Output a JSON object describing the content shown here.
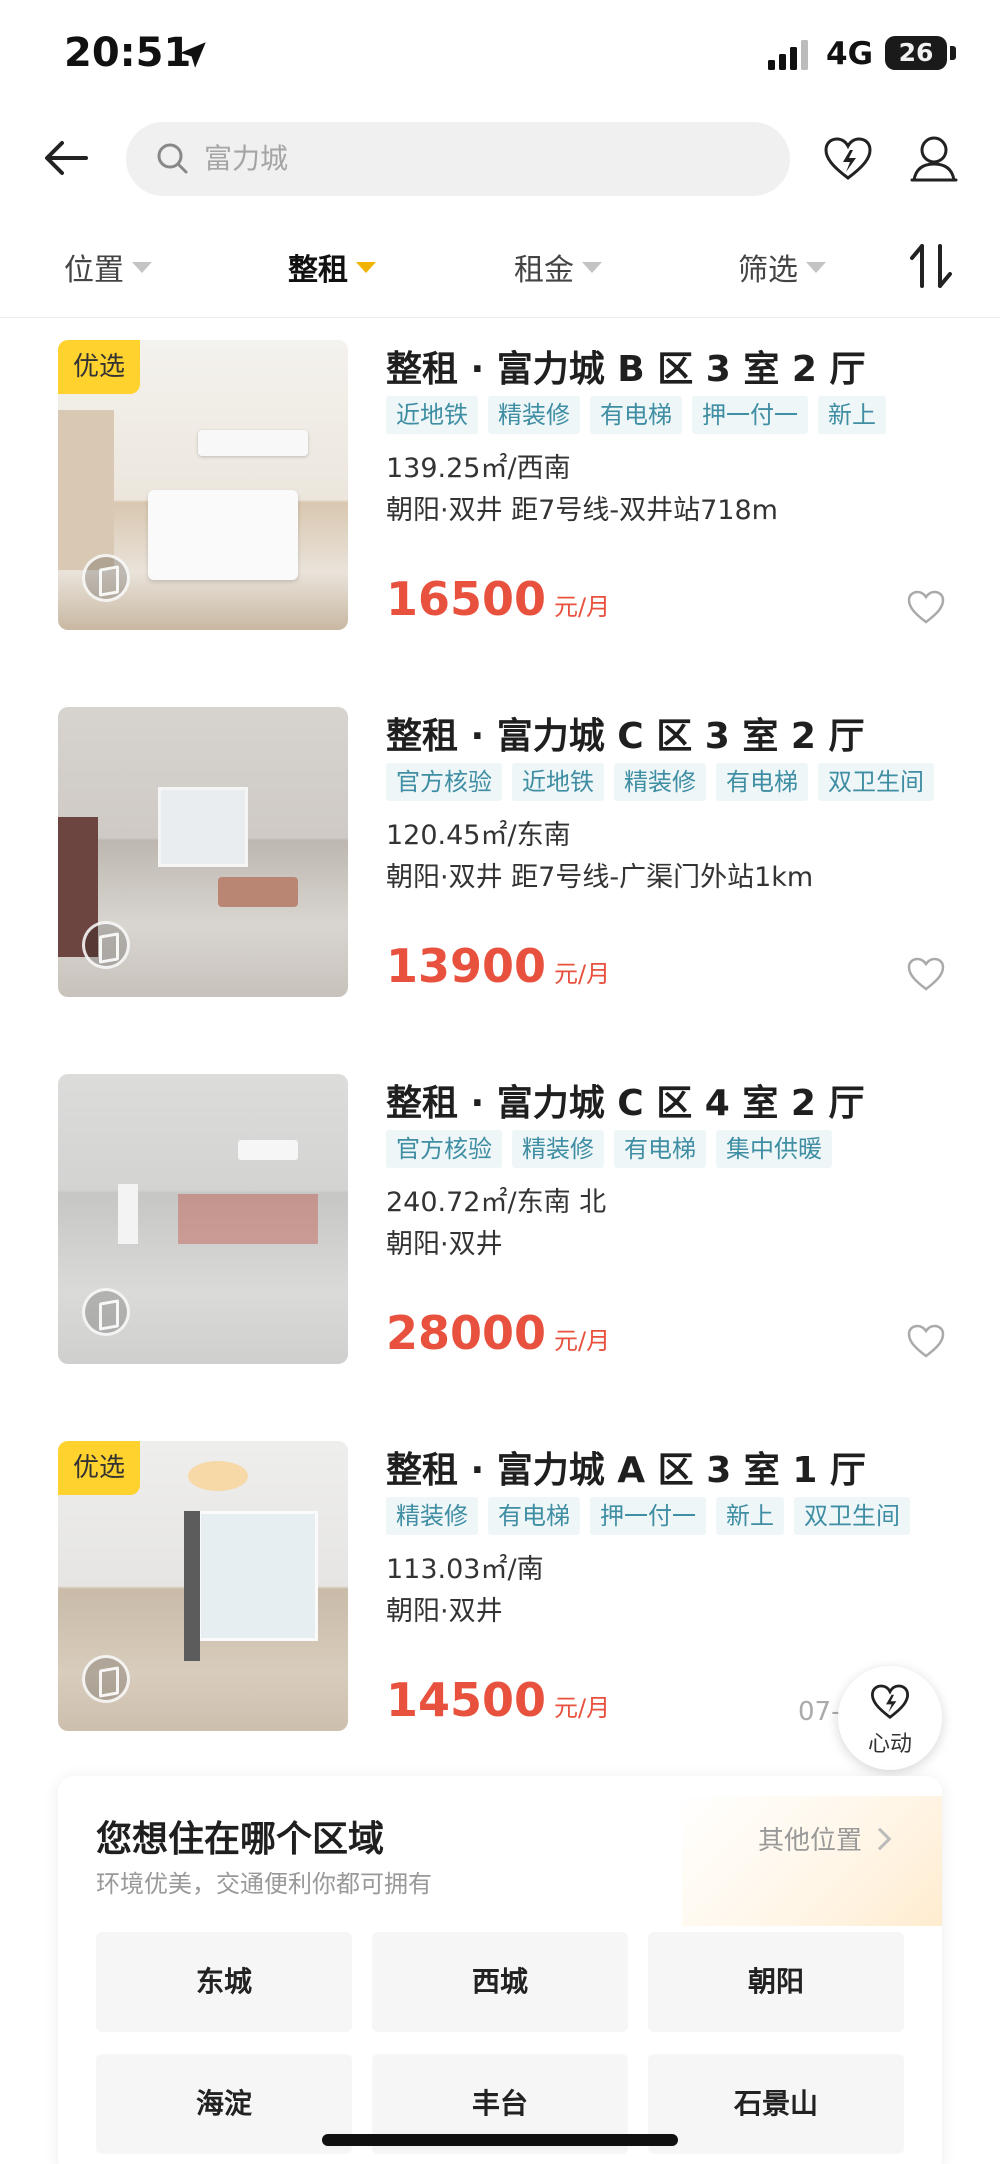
{
  "status_bar": {
    "time": "20:51",
    "network": "4G",
    "battery": "26"
  },
  "search": {
    "placeholder": "富力城"
  },
  "filters": [
    {
      "label": "位置"
    },
    {
      "label": "整租"
    },
    {
      "label": "租金"
    },
    {
      "label": "筛选"
    }
  ],
  "listings": [
    {
      "badge": "优选",
      "title": "整租 · 富力城 B 区 3 室 2 厅",
      "tags": [
        "近地铁",
        "精装修",
        "有电梯",
        "押一付一",
        "新上"
      ],
      "area_orientation": "139.25㎡/西南",
      "location": "朝阳·双井 距7号线-双井站718m",
      "price": "16500",
      "price_unit": "元/月"
    },
    {
      "title": "整租 · 富力城 C 区 3 室 2 厅",
      "tags": [
        "官方核验",
        "近地铁",
        "精装修",
        "有电梯",
        "双卫生间"
      ],
      "area_orientation": "120.45㎡/东南",
      "location": "朝阳·双井 距7号线-广渠门外站1km",
      "price": "13900",
      "price_unit": "元/月"
    },
    {
      "title": "整租 · 富力城 C 区 4 室 2 厅",
      "tags": [
        "官方核验",
        "精装修",
        "有电梯",
        "集中供暖"
      ],
      "area_orientation": "240.72㎡/东南 北",
      "location": "朝阳·双井",
      "price": "28000",
      "price_unit": "元/月"
    },
    {
      "badge": "优选",
      "title": "整租 · 富力城 A 区 3 室 1 厅",
      "tags": [
        "精装修",
        "有电梯",
        "押一付一",
        "新上",
        "双卫生间"
      ],
      "area_orientation": "113.03㎡/南",
      "location": "朝阳·双井",
      "price": "14500",
      "price_unit": "元/月",
      "date": "07-"
    }
  ],
  "float_button": {
    "label": "心动"
  },
  "region_panel": {
    "title": "您想住在哪个区域",
    "subtitle": "环境优美，交通便利你都可拥有",
    "more": "其他位置",
    "districts": [
      "东城",
      "西城",
      "朝阳",
      "海淀",
      "丰台",
      "石景山"
    ]
  },
  "colors": {
    "accent": "#ffd22e",
    "price": "#e8513d",
    "tag_text": "#3f8ea3",
    "tag_bg": "#eef6f8"
  },
  "icons": [
    "location-arrow-icon",
    "signal-icon",
    "back-arrow-icon",
    "search-icon",
    "heart-bolt-icon",
    "profile-icon",
    "sort-icon",
    "heart-icon",
    "vr-icon",
    "chevron-right-icon"
  ]
}
